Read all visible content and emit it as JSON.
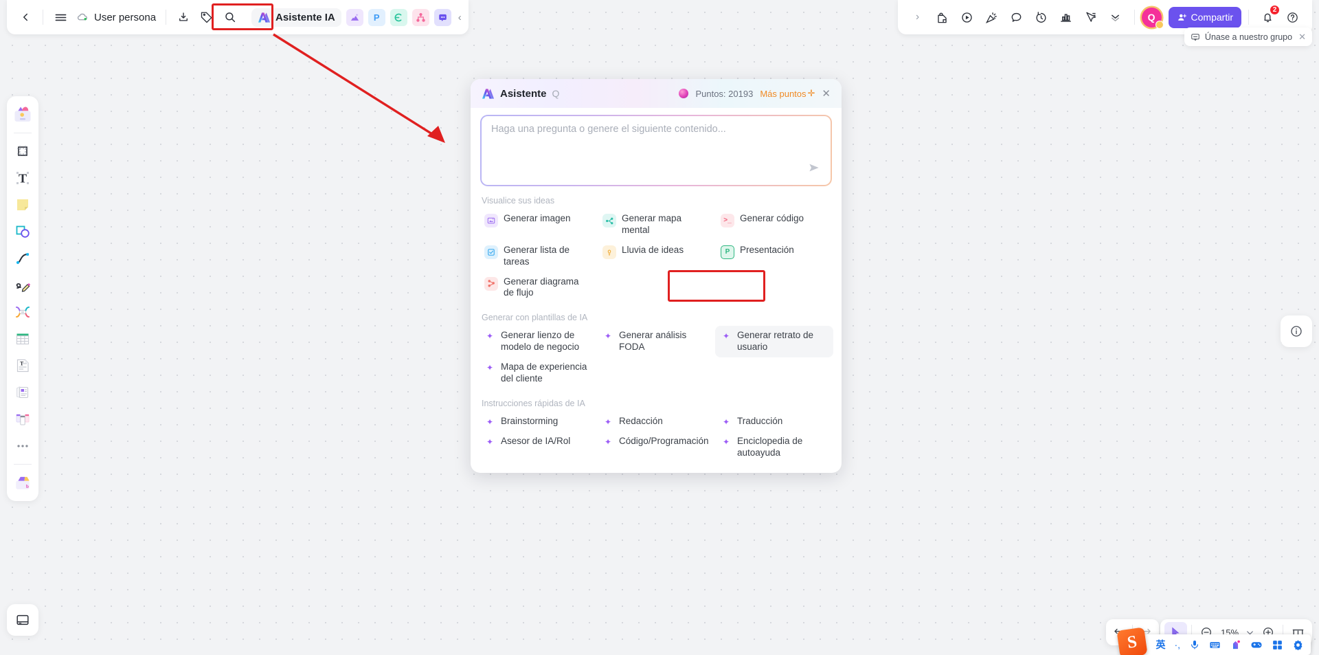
{
  "window": {
    "background_color": "#f2f3f5",
    "accent_color": "#6b52ee",
    "highlight_color": "#e02020"
  },
  "topbar_left": {
    "back_label": "‹",
    "menu_label": "☰",
    "document_title": "User persona",
    "icons": [
      {
        "name": "back-icon",
        "glyph": "‹"
      },
      {
        "name": "hamburger-menu-icon",
        "glyph": "☰"
      },
      {
        "name": "cloud-saved-icon",
        "glyph": "cloud"
      },
      {
        "name": "download-icon",
        "glyph": "download"
      },
      {
        "name": "tag-icon",
        "glyph": "tag"
      },
      {
        "name": "search-icon",
        "glyph": "search"
      }
    ],
    "ai_tab_label": "Asistente IA",
    "mini_apps": [
      {
        "name": "image-app",
        "glyph": "▲",
        "bg": "#efe6fd",
        "fg": "#9b6cf0"
      },
      {
        "name": "presentation-app",
        "glyph": "P",
        "bg": "#e2f0fe",
        "fg": "#3e9bf5"
      },
      {
        "name": "mindmap-app",
        "glyph": "C",
        "bg": "#d9f7ee",
        "fg": "#27c39a"
      },
      {
        "name": "flowchart-app",
        "glyph": "ᛧ",
        "bg": "#fde3ec",
        "fg": "#f4699b"
      },
      {
        "name": "comment-app",
        "glyph": "▮",
        "bg": "#e2e0fd",
        "fg": "#6b52ee"
      }
    ],
    "collapse_label": "‹"
  },
  "topbar_right": {
    "expand_label": "›",
    "icons": [
      {
        "name": "lock-note-icon"
      },
      {
        "name": "play-circle-icon"
      },
      {
        "name": "confetti-icon"
      },
      {
        "name": "comment-bubble-icon"
      },
      {
        "name": "timer-icon"
      },
      {
        "name": "chart-icon"
      },
      {
        "name": "cursor-presenter-icon"
      },
      {
        "name": "chevron-down-icon"
      }
    ],
    "avatar_initial": "Q",
    "share_label": "Compartir",
    "notification_count": "2",
    "help_label": "?"
  },
  "join_banner": {
    "label": "Únase a nuestro grupo",
    "close_label": "✕"
  },
  "left_rail": {
    "items": [
      {
        "name": "templates-icon",
        "label": "Plantillas"
      },
      {
        "name": "frame-icon",
        "label": "Marco"
      },
      {
        "name": "text-icon",
        "label": "Texto"
      },
      {
        "name": "sticky-note-icon",
        "label": "Nota adhesiva"
      },
      {
        "name": "shapes-icon",
        "label": "Formas"
      },
      {
        "name": "connector-icon",
        "label": "Conector"
      },
      {
        "name": "pen-icon",
        "label": "Lápiz"
      },
      {
        "name": "relation-icon",
        "label": "Relación"
      },
      {
        "name": "table-icon",
        "label": "Tabla"
      },
      {
        "name": "document-icon",
        "label": "Documento"
      },
      {
        "name": "card-icon",
        "label": "Tarjeta"
      },
      {
        "name": "kanban-icon",
        "label": "Kanban"
      },
      {
        "name": "more-tools-icon",
        "label": "Más"
      },
      {
        "name": "upload-icon",
        "label": "Subir"
      }
    ],
    "bottom_item": {
      "name": "layers-icon",
      "label": "Capas"
    }
  },
  "right_panel": {
    "info_label": "i"
  },
  "ai_panel": {
    "title": "Asistente",
    "subtitle": "Q",
    "points_label": "Puntos: 20193",
    "more_points_label": "Más puntos",
    "more_points_plus": "✛",
    "close_label": "✕",
    "prompt": {
      "placeholder": "Haga una pregunta o genere el siguiente contenido...",
      "value": "",
      "send_label": "➤"
    },
    "sections": [
      {
        "label": "Visualice sus ideas",
        "options": [
          {
            "name": "generate-image",
            "label": "Generar imagen",
            "icon_bg": "#f0e7fd",
            "icon_fg": "#9b6cf0",
            "icon": "▣",
            "active": false
          },
          {
            "name": "generate-mindmap",
            "label": "Generar mapa mental",
            "icon_bg": "#dff6f3",
            "icon_fg": "#2fbfa8",
            "icon": "⋖",
            "active": false
          },
          {
            "name": "generate-code",
            "label": "Generar código",
            "icon_bg": "#fde7ea",
            "icon_fg": "#f0607a",
            "icon": ">_",
            "active": false
          },
          {
            "name": "generate-task-list",
            "label": "Generar lista de tareas",
            "icon_bg": "#def1fd",
            "icon_fg": "#36a8ef",
            "icon": "☑",
            "active": false
          },
          {
            "name": "brainstorm-ideas",
            "label": "Lluvia de ideas",
            "icon_bg": "#fdf1da",
            "icon_fg": "#efa932",
            "icon": "♀",
            "active": false
          },
          {
            "name": "presentation",
            "label": "Presentación",
            "icon_bg": "#dff6ec",
            "icon_fg": "#2fb781",
            "icon": "P",
            "active": false
          },
          {
            "name": "generate-flowchart",
            "label": "Generar diagrama de flujo",
            "icon_bg": "#fde7e7",
            "icon_fg": "#f0726a",
            "icon": "⁑",
            "active": false
          }
        ]
      },
      {
        "label": "Generar con plantillas de IA",
        "options": [
          {
            "name": "business-model-canvas",
            "label": "Generar lienzo de modelo de negocio",
            "icon": "sparkle",
            "active": false
          },
          {
            "name": "swot-analysis",
            "label": "Generar análisis FODA",
            "icon": "sparkle",
            "active": false
          },
          {
            "name": "user-persona",
            "label": "Generar retrato de usuario",
            "icon": "sparkle",
            "active": true
          },
          {
            "name": "customer-journey-map",
            "label": "Mapa de experiencia del cliente",
            "icon": "sparkle",
            "active": false
          }
        ]
      },
      {
        "label": "Instrucciones rápidas de IA",
        "options": [
          {
            "name": "brainstorming",
            "label": "Brainstorming",
            "icon": "sparkle",
            "active": false
          },
          {
            "name": "writing",
            "label": "Redacción",
            "icon": "sparkle",
            "active": false
          },
          {
            "name": "translation",
            "label": "Traducción",
            "icon": "sparkle",
            "active": false
          },
          {
            "name": "ai-advisor-role",
            "label": "Asesor de IA/Rol",
            "icon": "sparkle",
            "active": false
          },
          {
            "name": "code-programming",
            "label": "Código/Programación",
            "icon": "sparkle",
            "active": false
          },
          {
            "name": "self-help-encyclopedia",
            "label": "Enciclopedia de autoayuda",
            "icon": "sparkle",
            "active": false
          }
        ]
      }
    ]
  },
  "bottom_controls": {
    "undo_label": "↶",
    "redo_label": "↷",
    "cursor_label": "cursor-icon",
    "zoom_out_label": "−",
    "zoom_level": "15%",
    "zoom_dropdown_label": "⌄",
    "zoom_in_label": "+",
    "fit_label": "fit-to-screen-icon"
  },
  "ime_bar": {
    "logo": "S",
    "lang_label": "英",
    "punct_label": "·,",
    "mic_label": "mic-icon",
    "keyboard_label": "keyboard-icon",
    "skin_label": "skin-icon",
    "games_label": "games-icon",
    "apps_label": "apps-icon",
    "settings_label": "settings-icon"
  }
}
